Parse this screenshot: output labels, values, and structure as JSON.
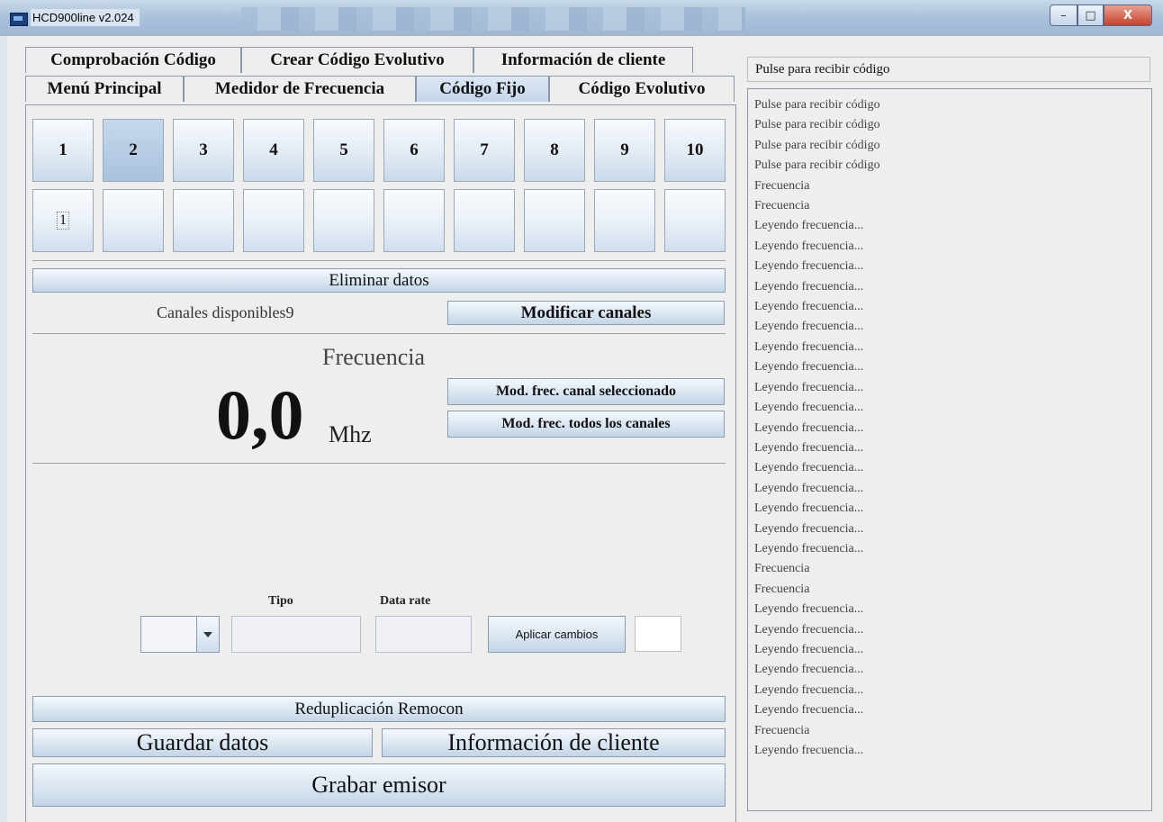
{
  "window": {
    "title": "HCD900line v2.024",
    "min": "–",
    "max": "□",
    "close": "X"
  },
  "tabs_row1": [
    "Comprobación Código",
    "Crear Código Evolutivo",
    "Información de cliente"
  ],
  "tabs_row2": [
    "Menú Principal",
    "Medidor de Frecuencia",
    "Código Fijo",
    "Código Evolutivo"
  ],
  "active_tab": "Código Fijo",
  "channels": [
    "1",
    "2",
    "3",
    "4",
    "5",
    "6",
    "7",
    "8",
    "9",
    "10"
  ],
  "selected_channel": "2",
  "channel_values": [
    "1",
    "",
    "",
    "",
    "",
    "",
    "",
    "",
    "",
    ""
  ],
  "buttons": {
    "eliminar": "Eliminar datos",
    "modificar": "Modificar canales",
    "mod_sel": "Mod. frec. canal seleccionado",
    "mod_all": "Mod. frec. todos los canales",
    "aplicar": "Aplicar cambios",
    "reduplicacion": "Reduplicación Remocon",
    "guardar": "Guardar datos",
    "info_cliente": "Información de cliente",
    "grabar": "Grabar emisor"
  },
  "canales_disponibles": "Canales disponibles9",
  "frecuencia": {
    "label": "Frecuencia",
    "value": "0,0",
    "unit": "Mhz"
  },
  "settings": {
    "tipo_label": "Tipo",
    "datarate_label": "Data rate",
    "combo_value": "",
    "tipo_value": "",
    "datarate_value": ""
  },
  "right": {
    "header": "Pulse para recibir código",
    "log": [
      "Pulse para recibir código",
      "Pulse para recibir código",
      "Pulse para recibir código",
      "Pulse para recibir código",
      "Frecuencia",
      "Frecuencia",
      "Leyendo frecuencia...",
      "Leyendo frecuencia...",
      "Leyendo frecuencia...",
      "Leyendo frecuencia...",
      "Leyendo frecuencia...",
      "Leyendo frecuencia...",
      "Leyendo frecuencia...",
      "Leyendo frecuencia...",
      "Leyendo frecuencia...",
      "Leyendo frecuencia...",
      "Leyendo frecuencia...",
      "Leyendo frecuencia...",
      "Leyendo frecuencia...",
      "Leyendo frecuencia...",
      "Leyendo frecuencia...",
      "Leyendo frecuencia...",
      "Leyendo frecuencia...",
      "Frecuencia",
      "Frecuencia",
      "Leyendo frecuencia...",
      "Leyendo frecuencia...",
      "Leyendo frecuencia...",
      "Leyendo frecuencia...",
      "Leyendo frecuencia...",
      "Leyendo frecuencia...",
      "Frecuencia",
      "Leyendo frecuencia..."
    ]
  }
}
